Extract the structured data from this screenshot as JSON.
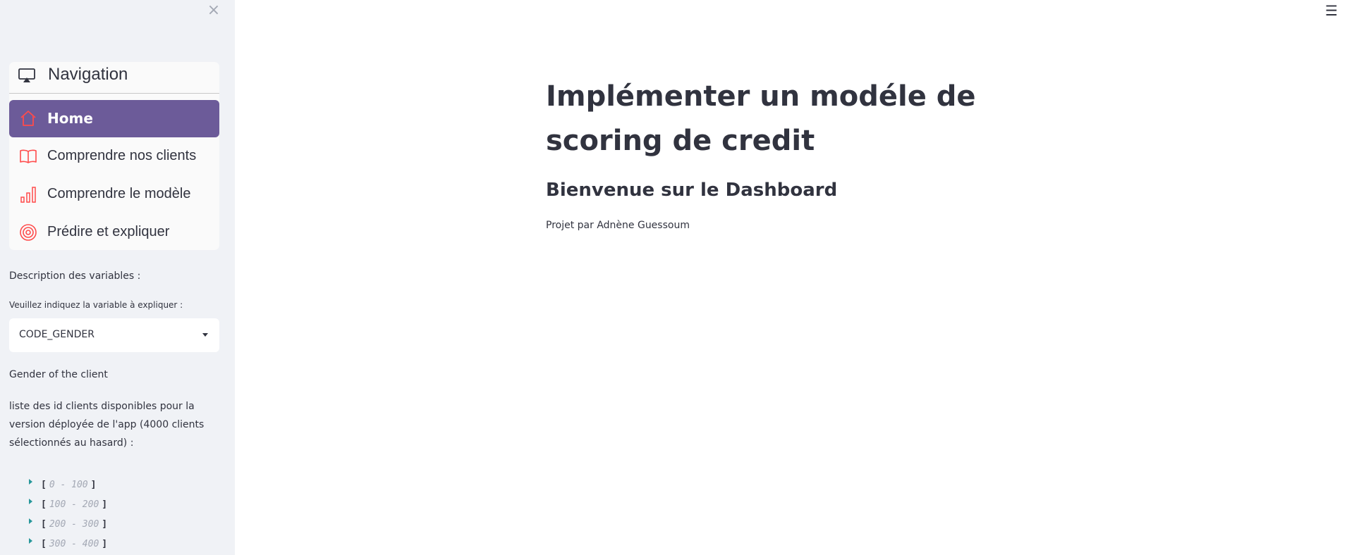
{
  "sidebar": {
    "close_icon": "×",
    "nav": {
      "title": "Navigation",
      "title_icon": "tv-icon",
      "accent_color": "#ff4b4b",
      "active_bg": "#6c5b99",
      "items": [
        {
          "label": "Home",
          "icon": "house-icon",
          "active": true
        },
        {
          "label": "Comprendre nos clients",
          "icon": "book-icon",
          "active": false
        },
        {
          "label": "Comprendre le modèle",
          "icon": "bar-chart-icon",
          "active": false
        },
        {
          "label": "Prédire et expliquer",
          "icon": "target-icon",
          "active": false
        }
      ]
    },
    "variables_heading": "Description des variables :",
    "variable_prompt": "Veuillez indiquez la variable à expliquer :",
    "variable_selected": "CODE_GENDER",
    "variable_description": "Gender of the client",
    "clients_text_lines": [
      "liste des id clients disponibles pour la",
      "version déployée de l'app (4000 clients",
      "sélectionnés au hasard) :"
    ],
    "ranges": [
      {
        "open": "[",
        "label": "0 - 100",
        "close": "]"
      },
      {
        "open": "[",
        "label": "100 - 200",
        "close": "]"
      },
      {
        "open": "[",
        "label": "200 - 300",
        "close": "]"
      },
      {
        "open": "[",
        "label": "300 - 400",
        "close": "]"
      }
    ]
  },
  "header": {
    "menu_icon": "☰"
  },
  "main": {
    "title": "Implémenter un modéle de scoring de credit",
    "subtitle": "Bienvenue sur le Dashboard",
    "credit": "Projet par Adnène Guessoum"
  }
}
